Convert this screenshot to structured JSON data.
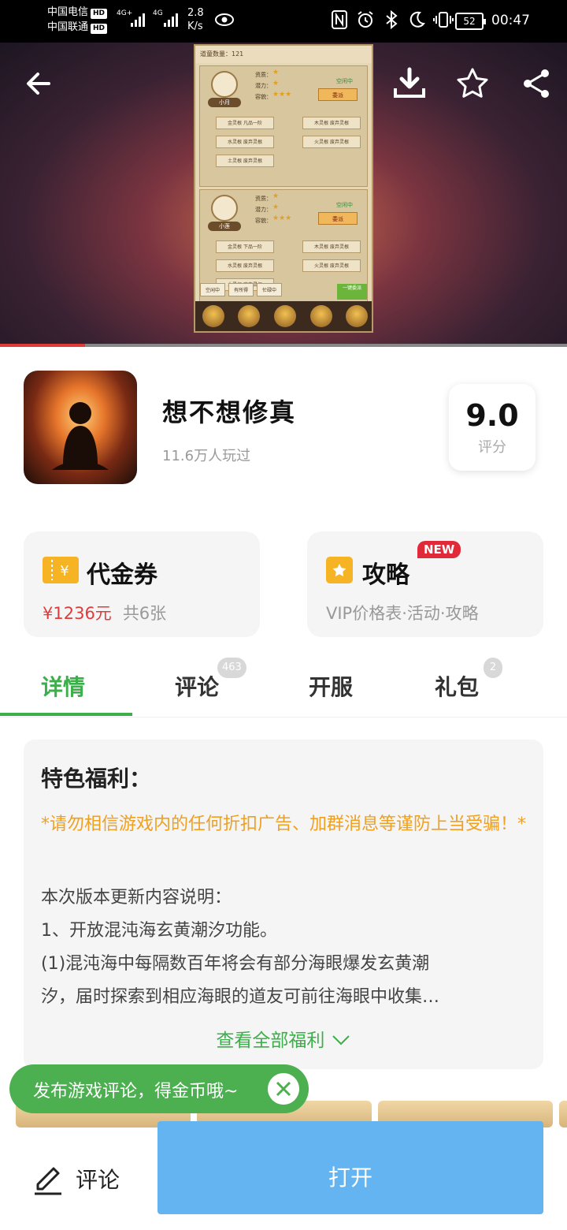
{
  "status_bar": {
    "carrier_1": "中国电信",
    "carrier_2": "中国联通",
    "hd": "HD",
    "net_1": "4G+",
    "net_2": "4G",
    "speed_value": "2.8",
    "speed_unit": "K/s",
    "battery": "52",
    "time": "00:47"
  },
  "hero": {
    "video_progress": 0.15,
    "game_screenshot": {
      "header": "道童数量：121",
      "disciples": [
        {
          "name": "小月",
          "attrs": [
            "资质：",
            "潜力：",
            "容貌："
          ],
          "status": "空闲中",
          "assign_btn": "委派",
          "roots": [
            "金灵根 凡品一阶",
            "木灵根 废弃灵根",
            "水灵根 废弃灵根",
            "火灵根 废弃灵根",
            "土灵根 废弃灵根"
          ]
        },
        {
          "name": "小莲",
          "attrs": [
            "资质：",
            "潜力：",
            "容貌："
          ],
          "status": "空闲中",
          "assign_btn": "委派",
          "roots": [
            "金灵根 下品一阶",
            "木灵根 废弃灵根",
            "水灵根 废弃灵根",
            "火灵根 废弃灵根",
            "土灵根 废弃灵根"
          ]
        }
      ],
      "filter_tabs": [
        "空闲中",
        "有所得",
        "忙碌中"
      ],
      "one_key": "一键委派",
      "nav": [
        "修炼",
        "道炉",
        "功法",
        "洞府",
        "阵法"
      ]
    }
  },
  "app": {
    "title": "想不想修真",
    "plays": "11.6万人玩过",
    "rating": "9.0",
    "rating_label": "评分"
  },
  "cards": {
    "voucher": {
      "title": "代金券",
      "price": "¥1236元",
      "count": "共6张"
    },
    "guide": {
      "title": "攻略",
      "badge": "NEW",
      "subtitle": "VIP价格表·活动·攻略"
    }
  },
  "tabs": [
    {
      "label": "详情",
      "badge": ""
    },
    {
      "label": "评论",
      "badge": "463"
    },
    {
      "label": "开服",
      "badge": ""
    },
    {
      "label": "礼包",
      "badge": "2"
    }
  ],
  "welfare": {
    "title": "特色福利：",
    "warning": "*请勿相信游戏内的任何折扣广告、加群消息等谨防上当受骗！*",
    "lines": [
      "本次版本更新内容说明：",
      "1、开放混沌海玄黄潮汐功能。",
      "(1)混沌海中每隔数百年将会有部分海眼爆发玄黄潮",
      "汐，届时探索到相应海眼的道友可前往海眼中收集…"
    ],
    "more": "查看全部福利"
  },
  "toast": {
    "text": "发布游戏评论，得金币哦~"
  },
  "bottom": {
    "comment": "评论",
    "open": "打开"
  },
  "colors": {
    "accent_green": "#3cae4a",
    "open_blue": "#63b4f0",
    "warning_orange": "#f0a020",
    "price_red": "#e03b3b",
    "badge_red": "#e02a3a"
  }
}
